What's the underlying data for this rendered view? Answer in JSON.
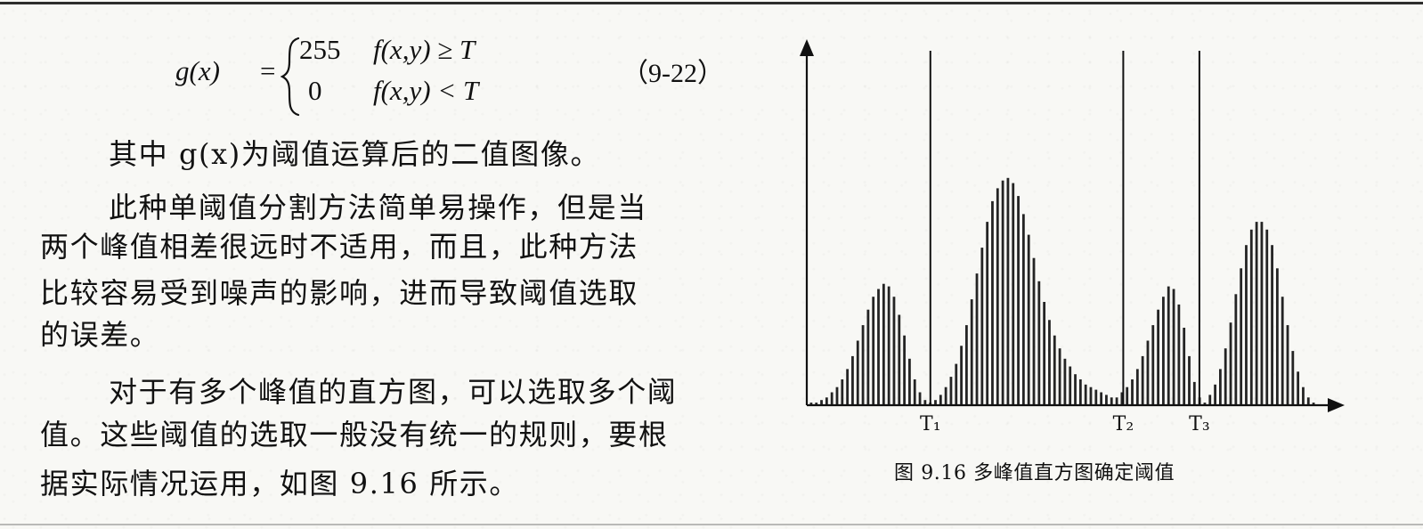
{
  "document": {
    "formula": {
      "lhs": "g(x)",
      "equals": "=",
      "case1_value": "255",
      "case1_condition": "f(x,y) ≥ T",
      "case2_value": "0",
      "case2_condition": "f(x,y) < T",
      "equation_number": "（9-22）"
    },
    "paragraph_lines": [
      "其中 g(x)为阈值运算后的二值图像。",
      "此种单阈值分割方法简单易操作，但是当",
      "两个峰值相差很远时不适用，而且，此种方法",
      "比较容易受到噪声的影响，进而导致阈值选取",
      "的误差。",
      "对于有多个峰值的直方图，可以选取多个阈",
      "值。这些阈值的选取一般没有统一的规则，要根",
      "据实际情况运用，如图 9.16 所示。"
    ]
  },
  "figure": {
    "caption": "图 9.16    多峰值直方图确定阈值",
    "thresholds": [
      {
        "label": "T₁"
      },
      {
        "label": "T₂"
      },
      {
        "label": "T₃"
      }
    ]
  },
  "chart_data": {
    "type": "bar",
    "title": "",
    "xlabel": "",
    "ylabel": "",
    "grid": false,
    "legend": "none",
    "x_range": [
      0,
      100
    ],
    "y_range": [
      0,
      100
    ],
    "series": [
      {
        "values": [
          1,
          1,
          2,
          3,
          5,
          7,
          10,
          14,
          19,
          25,
          31,
          37,
          42,
          45,
          47,
          46,
          42,
          35,
          27,
          18,
          10,
          5,
          2,
          1,
          2,
          4,
          7,
          11,
          16,
          23,
          31,
          41,
          51,
          61,
          71,
          79,
          84,
          87,
          88,
          86,
          81,
          74,
          66,
          57,
          48,
          40,
          33,
          27,
          22,
          18,
          15,
          12,
          10,
          8,
          7,
          6,
          5,
          4,
          3,
          3,
          5,
          7,
          10,
          14,
          19,
          25,
          31,
          37,
          42,
          46,
          45,
          39,
          30,
          19,
          9,
          3,
          1,
          4,
          8,
          14,
          22,
          32,
          43,
          53,
          62,
          68,
          71,
          71,
          68,
          62,
          53,
          42,
          31,
          21,
          13,
          7,
          3,
          1
        ]
      }
    ],
    "thresholds": [
      {
        "label": "T₁",
        "x": 24
      },
      {
        "label": "T₂",
        "x": 62
      },
      {
        "label": "T₃",
        "x": 77
      }
    ]
  }
}
